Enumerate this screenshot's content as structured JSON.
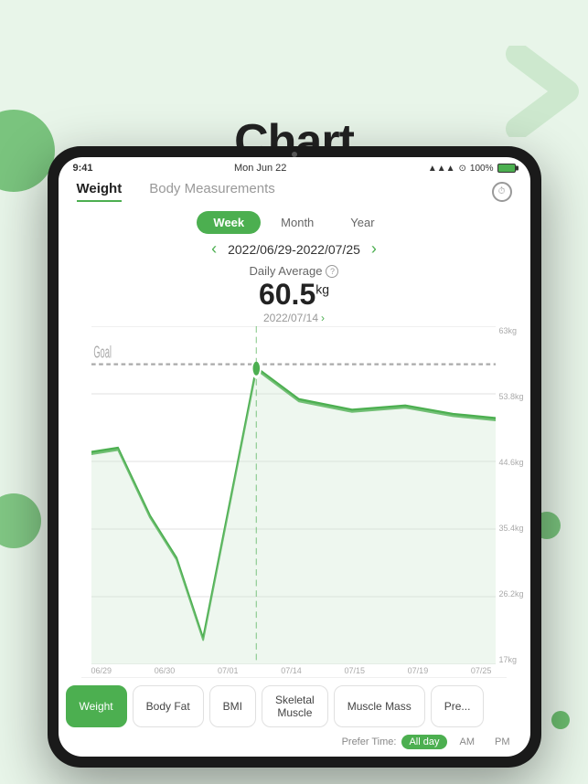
{
  "background": {
    "color": "#e8f5e9"
  },
  "page": {
    "title": "Chart"
  },
  "status_bar": {
    "time": "9:41",
    "date": "Mon Jun 22",
    "signal": "●●●",
    "wifi": "wifi",
    "battery": "100%"
  },
  "tabs": {
    "weight_label": "Weight",
    "body_measurements_label": "Body Measurements"
  },
  "period_buttons": [
    {
      "id": "week",
      "label": "Week",
      "active": true
    },
    {
      "id": "month",
      "label": "Month",
      "active": false
    },
    {
      "id": "year",
      "label": "Year",
      "active": false
    }
  ],
  "date_range": {
    "start": "2022/06/29",
    "end": "2022/07/25",
    "display": "2022/06/29-2022/07/25"
  },
  "daily_average": {
    "label": "Daily Average",
    "value": "60.5",
    "unit": "kg",
    "date": "2022/07/14"
  },
  "chart": {
    "goal_label": "Goal",
    "x_labels": [
      "06/29",
      "06/30",
      "07/01",
      "07/14",
      "07/15",
      "07/19",
      "07/25"
    ],
    "y_labels_right": [
      "63kg",
      "53.8kg",
      "44.6kg",
      "35.4kg",
      "26.2kg",
      "17kg"
    ]
  },
  "bottom_tabs": [
    {
      "label": "Weight",
      "active": true
    },
    {
      "label": "Body Fat",
      "active": false
    },
    {
      "label": "BMI",
      "active": false
    },
    {
      "label": "Skeletal Muscle",
      "active": false
    },
    {
      "label": "Muscle Mass",
      "active": false
    },
    {
      "label": "Pre...",
      "active": false
    }
  ],
  "prefer_time": {
    "label": "Prefer Time:",
    "options": [
      {
        "label": "All day",
        "active": true
      },
      {
        "label": "AM",
        "active": false
      },
      {
        "label": "PM",
        "active": false
      }
    ]
  }
}
